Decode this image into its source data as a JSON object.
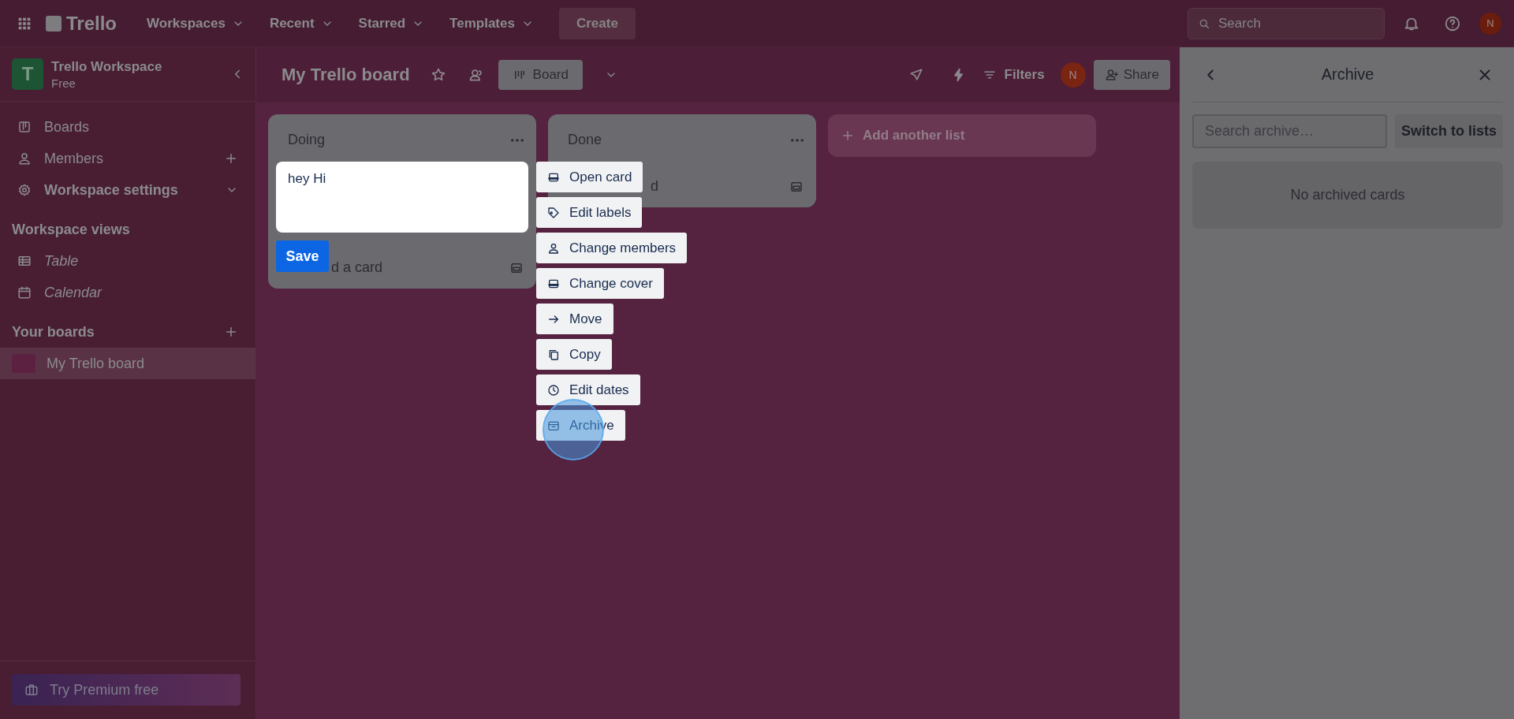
{
  "top_nav": {
    "logo": "Trello",
    "menus": [
      {
        "label": "Workspaces"
      },
      {
        "label": "Recent"
      },
      {
        "label": "Starred"
      },
      {
        "label": "Templates"
      }
    ],
    "create": "Create",
    "search": {
      "placeholder": "Search"
    },
    "avatar": "N"
  },
  "sidebar": {
    "workspace": {
      "initial": "T",
      "name": "Trello Workspace",
      "plan": "Free"
    },
    "items": [
      {
        "kind": "boards",
        "label": "Boards"
      },
      {
        "kind": "members",
        "label": "Members"
      },
      {
        "kind": "settings",
        "label": "Workspace settings"
      }
    ],
    "views_heading": "Workspace views",
    "views": [
      {
        "kind": "table",
        "label": "Table"
      },
      {
        "kind": "calendar",
        "label": "Calendar"
      }
    ],
    "boards_heading": "Your boards",
    "boards": [
      {
        "label": "My Trello board",
        "selected": true
      }
    ],
    "premium": "Try Premium free"
  },
  "board": {
    "title": "My Trello board",
    "view": "Board",
    "filters": "Filters",
    "avatar": "N",
    "share": "Share",
    "lists": [
      {
        "title": "Doing",
        "footer": "d a card"
      },
      {
        "title": "Done",
        "footer": "d"
      }
    ],
    "add_list": "Add another list"
  },
  "card_editor": {
    "text": "hey Hi",
    "save": "Save",
    "actions": [
      {
        "kind": "open",
        "label": "Open card"
      },
      {
        "kind": "labels",
        "label": "Edit labels"
      },
      {
        "kind": "members",
        "label": "Change members"
      },
      {
        "kind": "cover",
        "label": "Change cover"
      },
      {
        "kind": "move",
        "label": "Move"
      },
      {
        "kind": "copy",
        "label": "Copy"
      },
      {
        "kind": "dates",
        "label": "Edit dates"
      },
      {
        "kind": "archive",
        "label": "Archive"
      }
    ]
  },
  "archive_panel": {
    "title": "Archive",
    "search": {
      "placeholder": "Search archive…"
    },
    "switch": "Switch to lists",
    "empty": "No archived cards"
  }
}
